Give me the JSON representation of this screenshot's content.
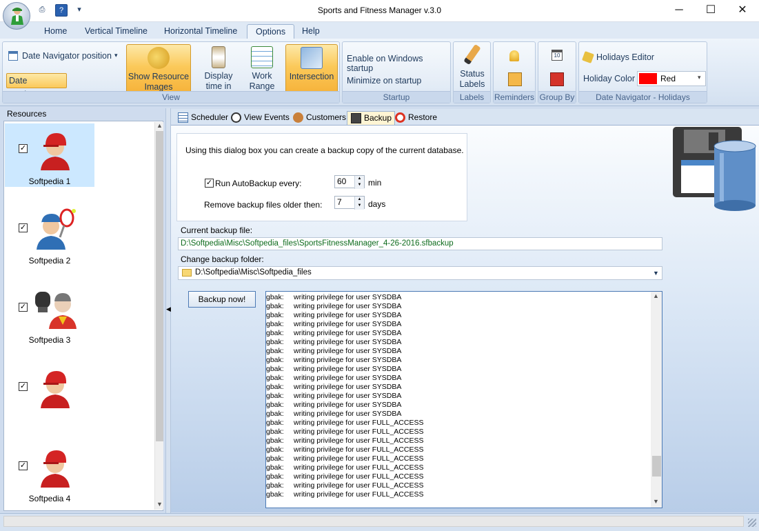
{
  "window": {
    "title": "Sports and Fitness Manager v.3.0",
    "minimize_glyph": "─",
    "maximize_glyph": "☐",
    "close_glyph": "✕",
    "qat": [
      "print-icon",
      "help-icon",
      "customize-icon"
    ],
    "qat_glyphs": [
      "⎙",
      "?",
      "▾"
    ]
  },
  "ribbon_tabs": [
    "Home",
    "Vertical Timeline",
    "Horizontal Timeline",
    "Options",
    "Help"
  ],
  "active_ribbon_tab": "Options",
  "ribbon": {
    "view": {
      "label": "View",
      "date_navigator_position": "Date Navigator position",
      "date_navigator": "Date Navigator",
      "show_resource_images": "Show Resource Images",
      "display_time_in": "Display time in",
      "work_range": "Work Range",
      "intersection": "Intersection"
    },
    "startup": {
      "label": "Startup",
      "enable_on_windows_startup": "Enable on Windows startup",
      "minimize_on_startup": "Minimize on startup"
    },
    "labels": {
      "label": "Labels",
      "status_labels": "Status Labels"
    },
    "reminders": {
      "label": "Reminders"
    },
    "group_by": {
      "label": "Group By"
    },
    "holidays": {
      "label": "Date Navigator - Holidays",
      "holidays_editor": "Holidays Editor",
      "holiday_color_label": "Holiday Color",
      "holiday_color_value": "Red",
      "holiday_color_swatch": "#ff0000"
    }
  },
  "resources": {
    "title": "Resources",
    "items": [
      {
        "name": "Softpedia 1",
        "checked": true,
        "selected": true,
        "icon": "red-cap-person-icon"
      },
      {
        "name": "Softpedia 2",
        "checked": true,
        "selected": false,
        "icon": "tennis-player-icon"
      },
      {
        "name": "Softpedia 3",
        "checked": true,
        "selected": false,
        "icon": "boxing-coach-icon"
      },
      {
        "name": "",
        "checked": true,
        "selected": false,
        "icon": "red-cap-person-icon"
      },
      {
        "name": "Softpedia 4",
        "checked": true,
        "selected": false,
        "icon": "red-cap-person-icon"
      }
    ]
  },
  "doc_tabs": [
    "Scheduler",
    "View Events",
    "Customers",
    "Backup",
    "Restore"
  ],
  "active_doc_tab": "Backup",
  "backup": {
    "intro": "Using this dialog box you can create a backup copy of the current database.",
    "autobackup_label": "Run AutoBackup every:",
    "autobackup_checked": true,
    "autobackup_value": "60",
    "autobackup_unit": "min",
    "remove_label": "Remove backup files older then:",
    "remove_value": "7",
    "remove_unit": "days",
    "current_file_label": "Current backup file:",
    "current_file_value": "D:\\Softpedia\\Misc\\Softpedia_files\\SportsFitnessManager_4-26-2016.sfbackup",
    "change_folder_label": "Change backup folder:",
    "folder_value": "D:\\Softpedia\\Misc\\Softpedia_files",
    "backup_button": "Backup now!",
    "log_prefix": "gbak:",
    "log_lines": [
      "writing privilege for user SYSDBA",
      "writing privilege for user SYSDBA",
      "writing privilege for user SYSDBA",
      "writing privilege for user SYSDBA",
      "writing privilege for user SYSDBA",
      "writing privilege for user SYSDBA",
      "writing privilege for user SYSDBA",
      "writing privilege for user SYSDBA",
      "writing privilege for user SYSDBA",
      "writing privilege for user SYSDBA",
      "writing privilege for user SYSDBA",
      "writing privilege for user SYSDBA",
      "writing privilege for user SYSDBA",
      "writing privilege for user SYSDBA",
      "writing privilege for user FULL_ACCESS",
      "writing privilege for user FULL_ACCESS",
      "writing privilege for user FULL_ACCESS",
      "writing privilege for user FULL_ACCESS",
      "writing privilege for user FULL_ACCESS",
      "writing privilege for user FULL_ACCESS",
      "writing privilege for user FULL_ACCESS",
      "writing privilege for user FULL_ACCESS",
      "writing privilege for user FULL_ACCESS"
    ]
  },
  "colors": {
    "accent": "#fbc95a",
    "ribbon": "#dce7f4",
    "selection": "#cce8ff"
  }
}
